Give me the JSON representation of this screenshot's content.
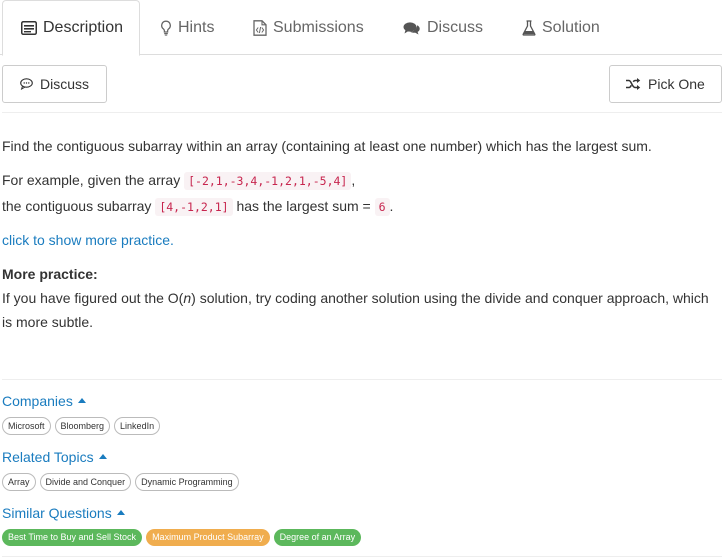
{
  "tabs": [
    {
      "label": "Description",
      "icon": "description-icon",
      "active": true
    },
    {
      "label": "Hints",
      "icon": "bulb-icon"
    },
    {
      "label": "Submissions",
      "icon": "code-file-icon"
    },
    {
      "label": "Discuss",
      "icon": "comments-icon"
    },
    {
      "label": "Solution",
      "icon": "flask-icon"
    }
  ],
  "toolbar": {
    "discuss_label": "Discuss",
    "pick_one_label": "Pick One"
  },
  "problem": {
    "statement": "Find the contiguous subarray within an array (containing at least one number) which has the largest sum.",
    "example_prefix": "For example, given the array ",
    "example_array": "[-2,1,-3,4,-1,2,1,-5,4]",
    "example_suffix": ",",
    "result_prefix": "the contiguous subarray ",
    "result_array": "[4,-1,2,1]",
    "result_middle": " has the largest sum = ",
    "result_value": "6",
    "result_suffix": ".",
    "more_link": "click to show more practice.",
    "more_heading": "More practice:",
    "more_line1_a": "If you have figured out the O(",
    "more_line1_n": "n",
    "more_line1_b": ") solution, try coding another solution using the divide and conquer approach, which",
    "more_line2": "is more subtle."
  },
  "companies": {
    "title": "Companies",
    "tags": [
      "Microsoft",
      "Bloomberg",
      "LinkedIn"
    ]
  },
  "related_topics": {
    "title": "Related Topics",
    "tags": [
      "Array",
      "Divide and Conquer",
      "Dynamic Programming"
    ]
  },
  "similar_questions": {
    "title": "Similar Questions",
    "tags": [
      {
        "label": "Best Time to Buy and Sell Stock",
        "difficulty": "easy",
        "color": "#5cb85c"
      },
      {
        "label": "Maximum Product Subarray",
        "difficulty": "medium",
        "color": "#f0ad4e"
      },
      {
        "label": "Degree of an Array",
        "difficulty": "easy",
        "color": "#5cb85c"
      }
    ]
  }
}
